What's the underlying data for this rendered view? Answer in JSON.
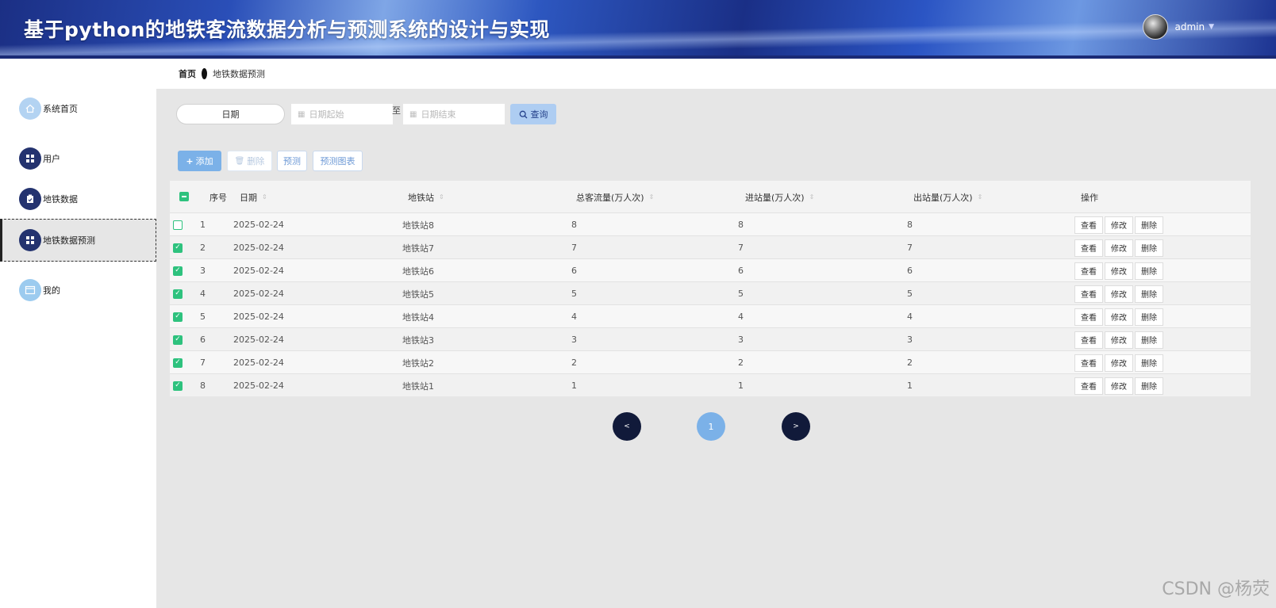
{
  "header": {
    "title": "基于python的地铁客流数据分析与预测系统的设计与实现",
    "username": "admin",
    "caret_icon": "caret-down-icon"
  },
  "sidebar": {
    "items": [
      {
        "label": "系统首页",
        "icon": "home-icon"
      },
      {
        "label": "用户",
        "icon": "grid-icon"
      },
      {
        "label": "地铁数据",
        "icon": "clipboard-icon"
      },
      {
        "label": "地铁数据预测",
        "icon": "grid-icon"
      },
      {
        "label": "我的",
        "icon": "window-icon"
      }
    ]
  },
  "breadcrumb": {
    "home": "首页",
    "current": "地铁数据预测"
  },
  "search": {
    "label": "日期",
    "start_placeholder": "日期起始",
    "end_placeholder": "日期结束",
    "range_separator": "至",
    "query_label": "查询"
  },
  "toolbar": {
    "add_label": "添加",
    "delete_label": "删除",
    "predict_label": "预测",
    "chart_label": "预测图表"
  },
  "table": {
    "columns": {
      "index": "序号",
      "date": "日期",
      "station": "地铁站",
      "total": "总客流量(万人次)",
      "in": "进站量(万人次)",
      "out": "出站量(万人次)",
      "ops": "操作"
    },
    "rows": [
      {
        "checked": false,
        "index": "1",
        "date": "2025-02-24",
        "station": "地铁站8",
        "total": "8",
        "in": "8",
        "out": "8"
      },
      {
        "checked": true,
        "index": "2",
        "date": "2025-02-24",
        "station": "地铁站7",
        "total": "7",
        "in": "7",
        "out": "7"
      },
      {
        "checked": true,
        "index": "3",
        "date": "2025-02-24",
        "station": "地铁站6",
        "total": "6",
        "in": "6",
        "out": "6"
      },
      {
        "checked": true,
        "index": "4",
        "date": "2025-02-24",
        "station": "地铁站5",
        "total": "5",
        "in": "5",
        "out": "5"
      },
      {
        "checked": true,
        "index": "5",
        "date": "2025-02-24",
        "station": "地铁站4",
        "total": "4",
        "in": "4",
        "out": "4"
      },
      {
        "checked": true,
        "index": "6",
        "date": "2025-02-24",
        "station": "地铁站3",
        "total": "3",
        "in": "3",
        "out": "3"
      },
      {
        "checked": true,
        "index": "7",
        "date": "2025-02-24",
        "station": "地铁站2",
        "total": "2",
        "in": "2",
        "out": "2"
      },
      {
        "checked": true,
        "index": "8",
        "date": "2025-02-24",
        "station": "地铁站1",
        "total": "1",
        "in": "1",
        "out": "1"
      }
    ],
    "ops": {
      "view": "查看",
      "edit": "修改",
      "delete": "删除"
    }
  },
  "pagination": {
    "prev": "<",
    "current": "1",
    "next": ">"
  },
  "watermark": "CSDN @杨荧",
  "colors": {
    "accent": "#7bb1e8",
    "check": "#2ec27e",
    "nav_dark": "#111a3a"
  }
}
